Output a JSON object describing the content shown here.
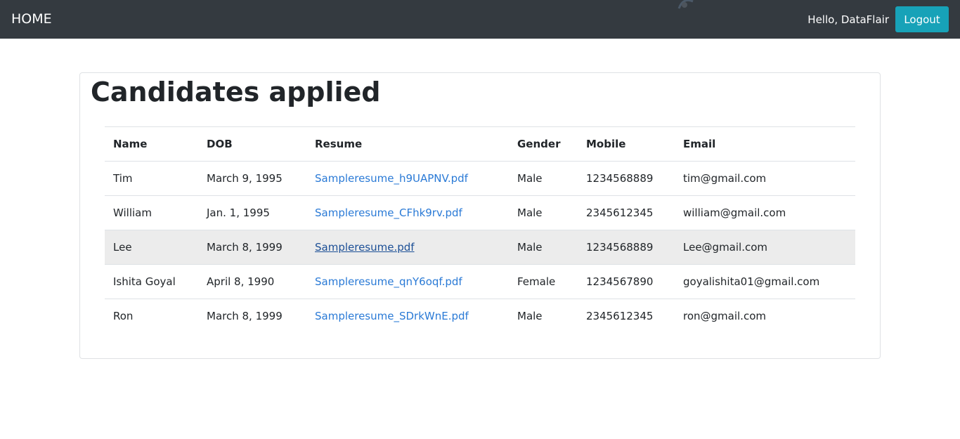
{
  "navbar": {
    "brand": "HOME",
    "greeting": "Hello, DataFlair",
    "logout_label": "Logout"
  },
  "main": {
    "title": "Candidates applied",
    "columns": [
      "Name",
      "DOB",
      "Resume",
      "Gender",
      "Mobile",
      "Email"
    ],
    "rows": [
      {
        "name": "Tim",
        "dob": "March 9, 1995",
        "resume": "Sampleresume_h9UAPNV.pdf",
        "gender": "Male",
        "mobile": "1234568889",
        "email": "tim@gmail.com"
      },
      {
        "name": "William",
        "dob": "Jan. 1, 1995",
        "resume": "Sampleresume_CFhk9rv.pdf",
        "gender": "Male",
        "mobile": "2345612345",
        "email": "william@gmail.com"
      },
      {
        "name": "Lee",
        "dob": "March 8, 1999",
        "resume": "Sampleresume.pdf",
        "gender": "Male",
        "mobile": "1234568889",
        "email": "Lee@gmail.com"
      },
      {
        "name": "Ishita Goyal",
        "dob": "April 8, 1990",
        "resume": "Sampleresume_qnY6oqf.pdf",
        "gender": "Female",
        "mobile": "1234567890",
        "email": "goyalishita01@gmail.com"
      },
      {
        "name": "Ron",
        "dob": "March 8, 1999",
        "resume": "Sampleresume_SDrkWnE.pdf",
        "gender": "Male",
        "mobile": "2345612345",
        "email": "ron@gmail.com"
      }
    ]
  },
  "colors": {
    "navbar_bg": "#343a40",
    "logout_bg": "#17a2b8",
    "link": "#2a7ad6",
    "row_hover": "#ececec"
  }
}
